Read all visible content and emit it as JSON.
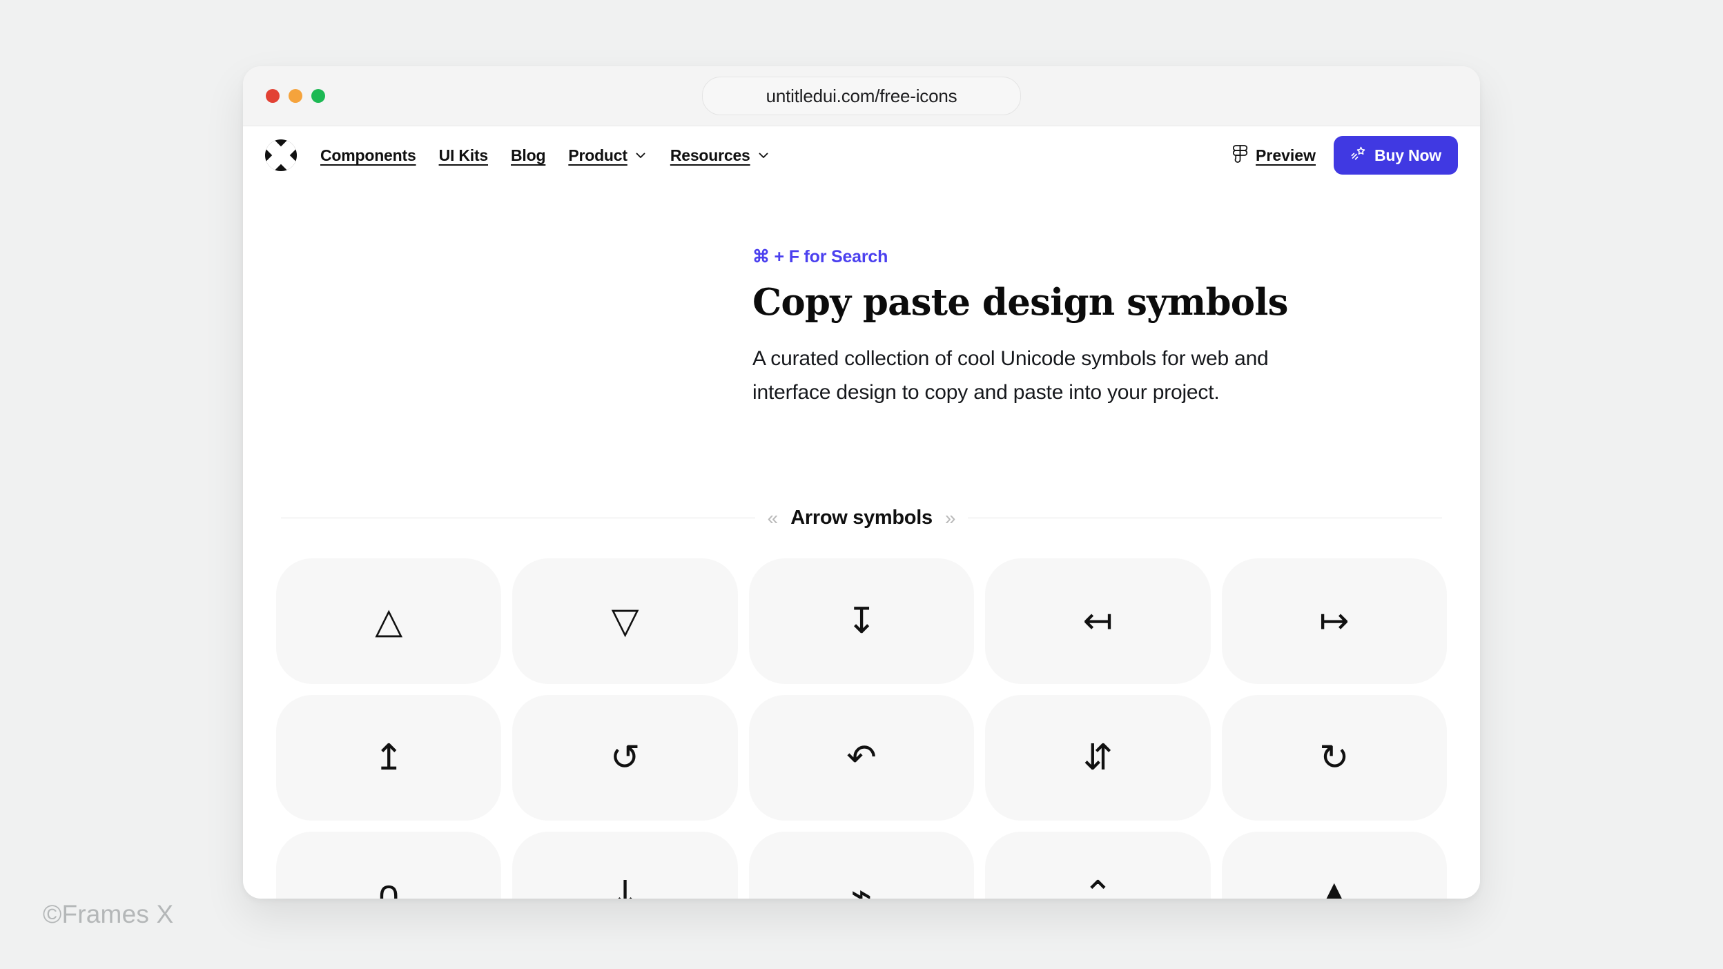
{
  "watermark": "©Frames X",
  "browser": {
    "url": "untitledui.com/free-icons",
    "traffic_lights": [
      "close",
      "minimize",
      "maximize"
    ]
  },
  "nav": {
    "logo_name": "untitled-ui-logo",
    "links": [
      {
        "label": "Components",
        "has_dropdown": false
      },
      {
        "label": "UI Kits",
        "has_dropdown": false
      },
      {
        "label": "Blog",
        "has_dropdown": false
      },
      {
        "label": "Product",
        "has_dropdown": true
      },
      {
        "label": "Resources",
        "has_dropdown": true
      }
    ],
    "preview_label": "Preview",
    "buy_label": "Buy Now",
    "buy_color": "#4039e2"
  },
  "hero": {
    "eyebrow": "⌘ + F for Search",
    "eyebrow_color": "#4b40ef",
    "title": "Copy paste design symbols",
    "subtitle": "A curated collection of cool Unicode symbols for web and interface design to copy and paste into your project."
  },
  "section": {
    "label": "Arrow symbols",
    "left_guillemet": "«",
    "right_guillemet": "»"
  },
  "symbols": [
    {
      "glyph": "△",
      "name": "white-up-pointing-triangle"
    },
    {
      "glyph": "▽",
      "name": "white-down-pointing-triangle"
    },
    {
      "glyph": "↧",
      "name": "downwards-arrow-to-bar"
    },
    {
      "glyph": "↤",
      "name": "leftwards-arrow-from-bar"
    },
    {
      "glyph": "↦",
      "name": "rightwards-arrow-from-bar"
    },
    {
      "glyph": "↥",
      "name": "upwards-arrow-to-bar"
    },
    {
      "glyph": "↺",
      "name": "anticlockwise-open-circle-arrow"
    },
    {
      "glyph": "↶",
      "name": "anticlockwise-top-semicircle-arrow"
    },
    {
      "glyph": "⇵",
      "name": "downwards-arrow-leftwards-of-upwards-arrow"
    },
    {
      "glyph": "↻",
      "name": "clockwise-open-circle-arrow"
    },
    {
      "glyph": "∩",
      "name": "intersection-arc-symbol"
    },
    {
      "glyph": "↓",
      "name": "downwards-arrow"
    },
    {
      "glyph": "⌁",
      "name": "electric-arrow"
    },
    {
      "glyph": "⌃",
      "name": "up-arrowhead"
    },
    {
      "glyph": "▲",
      "name": "black-up-pointing-triangle"
    }
  ]
}
